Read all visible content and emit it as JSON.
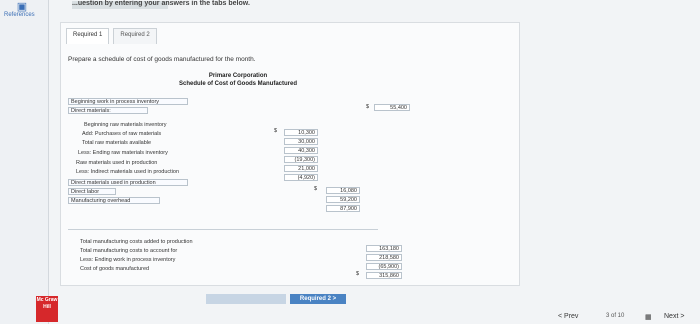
{
  "sidebar": {
    "references_label": "References",
    "logo_text": "Mc Graw Hill"
  },
  "header": {
    "instruction": "...uestion by entering your answers in the tabs below."
  },
  "tabs": [
    {
      "label": "Required 1"
    },
    {
      "label": "Required 2"
    }
  ],
  "prompt": "Prepare a schedule of cost of goods manufactured for the month.",
  "schedule": {
    "company": "Primare Corporation",
    "title": "Schedule of Cost of Goods Manufactured",
    "lines": {
      "bwip": {
        "label": "Beginning work in process inventory",
        "value": "55,400",
        "dollar": "$"
      },
      "direct_materials": {
        "label": "Direct materials:"
      },
      "beg_raw": {
        "label": "Beginning raw materials inventory",
        "value": "10,300",
        "dollar": "$"
      },
      "purchases": {
        "label": "Add: Purchases of raw materials",
        "value": "30,000"
      },
      "total_raw": {
        "label": "Total raw materials available",
        "value": "40,300"
      },
      "end_raw": {
        "label": "Less: Ending raw materials inventory",
        "value": "(19,300)"
      },
      "raw_used": {
        "label": "Raw materials used in production",
        "value": "21,000"
      },
      "indirect": {
        "label": "Less: Indirect materials used in production",
        "value": "(4,920)"
      },
      "dm_used": {
        "label": "Direct materials used in production",
        "value": "16,080",
        "dollar": "$"
      },
      "direct_labor": {
        "label": "Direct labor",
        "value": "59,200"
      },
      "overhead": {
        "label": "Manufacturing overhead",
        "value": "87,900"
      },
      "total_added": {
        "label": "Total manufacturing costs added to production",
        "value": "163,180"
      },
      "total_account": {
        "label": "Total manufacturing costs to account for",
        "value": "218,580"
      },
      "ewip": {
        "label": "Less: Ending work in process inventory",
        "value": "(65,900)"
      },
      "cogm": {
        "label": "Cost of goods manufactured",
        "value": "315,860",
        "dollar": "$"
      }
    }
  },
  "nav": {
    "required2_button": "Required 2 >",
    "prev": "< Prev",
    "page": "3 of 10",
    "next": "Next >"
  }
}
